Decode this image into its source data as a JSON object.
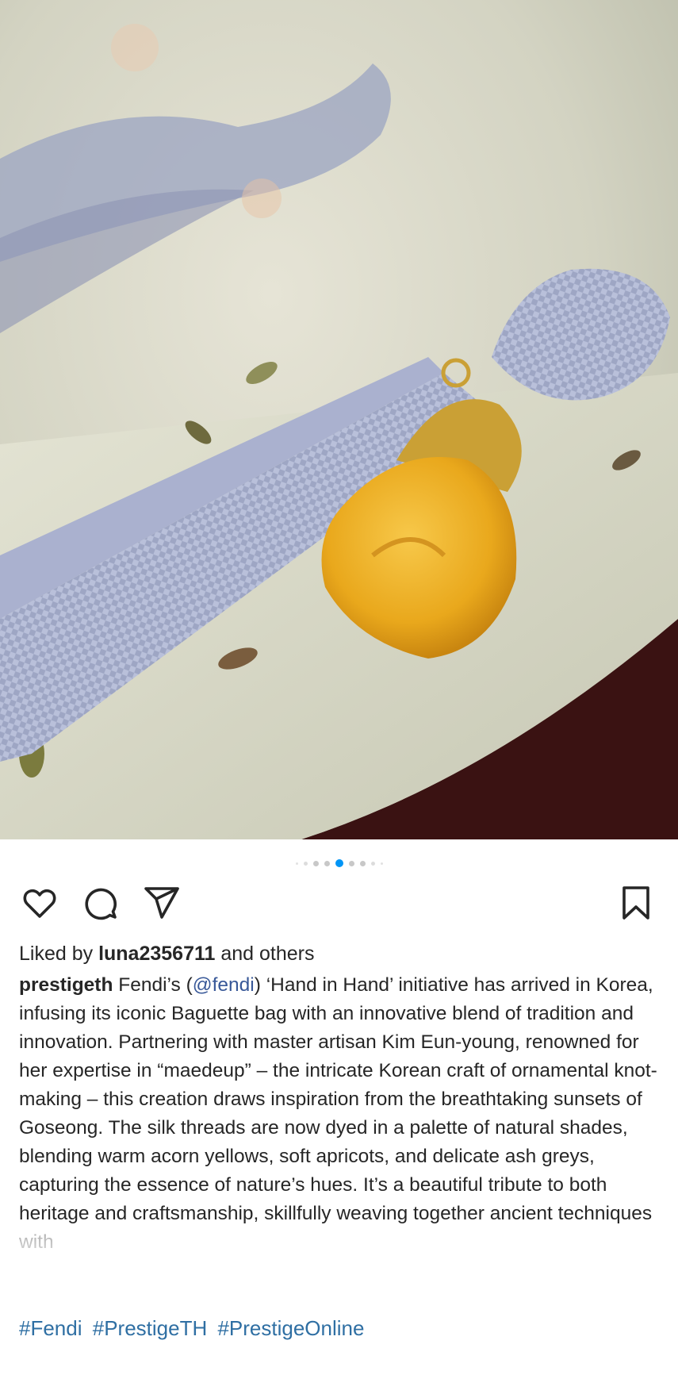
{
  "post": {
    "photo": {
      "alt_icon": "post-photo"
    },
    "carousel": {
      "count": 9,
      "active_index": 4
    },
    "likes": {
      "prefix": "Liked by ",
      "user": "luna2356711",
      "suffix": " and others"
    },
    "caption": {
      "author": "prestigeth",
      "text_1": " Fendi’s (",
      "mention": "@fendi",
      "text_2": ") ‘Hand in Hand’ initiative has arrived in Korea, infusing its iconic Baguette bag with an innovative blend of tradition and innovation. Partnering with master artisan Kim Eun-young, renowned for her expertise in “maedeup” – the intricate Korean craft of ornamental knot-making – this creation draws inspiration from the breathtaking sunsets of Goseong. The silk threads are now dyed in a palette of natural shades, blending warm acorn yellows, soft apricots, and delicate ash greys, capturing the essence of nature’s hues. It’s a beautiful tribute to both heritage and craftsmanship, skillfully weaving together ancient techniques with"
    },
    "hashtags": [
      "#Fendi",
      "#PrestigeTH",
      "#PrestigeOnline"
    ],
    "icons": {
      "like": "heart-icon",
      "comment": "comment-icon",
      "share": "send-icon",
      "save": "bookmark-icon"
    },
    "colors": {
      "accent": "#0095f6",
      "link": "#2f6fa3"
    }
  }
}
